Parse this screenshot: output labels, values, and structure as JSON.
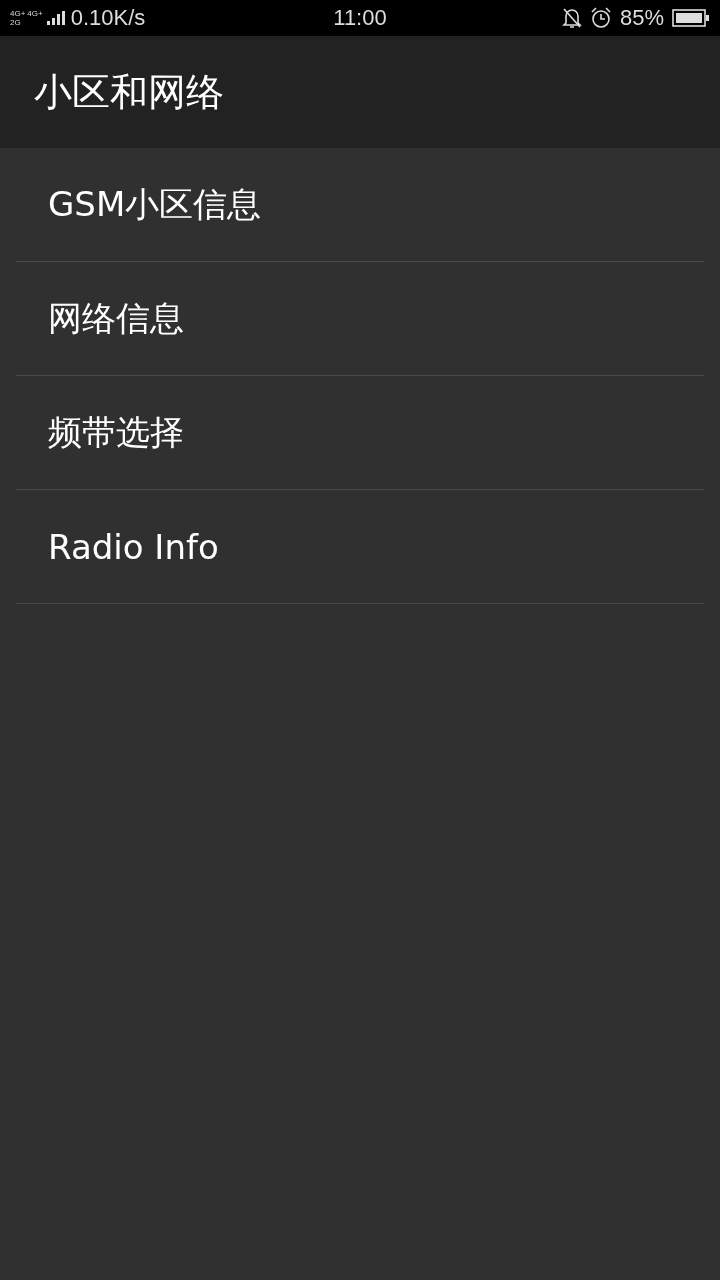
{
  "status_bar": {
    "networks": [
      "4G+",
      "4G+",
      "2G"
    ],
    "speed": "0.10K/s",
    "time": "11:00",
    "battery": "85%"
  },
  "header": {
    "title": "小区和网络"
  },
  "items": [
    {
      "label": "GSM小区信息"
    },
    {
      "label": "网络信息"
    },
    {
      "label": "频带选择"
    },
    {
      "label": "Radio Info"
    }
  ]
}
